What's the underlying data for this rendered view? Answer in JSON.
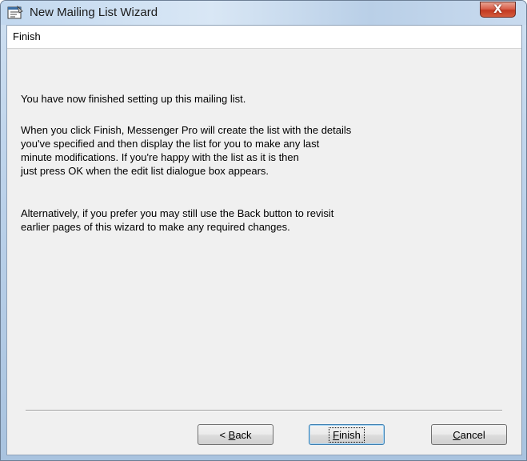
{
  "window": {
    "title": "New Mailing List Wizard",
    "close_glyph": "X",
    "app_icon": "wizard-icon"
  },
  "page": {
    "header": "Finish",
    "paragraphs": [
      "You have now finished setting up this mailing list.",
      "When you click Finish, Messenger Pro will create the list with the details\nyou've specified and then display the list for you to make any last\nminute modifications.  If you're happy with the list as it is then\njust press OK when the edit list dialogue box appears.",
      "Alternatively, if you prefer you may still use the Back button to revisit\nearlier pages of this wizard to make any required changes."
    ]
  },
  "buttons": {
    "back": {
      "label": "< Back",
      "accel_prefix": "< ",
      "accel_key": "B",
      "accel_rest": "ack"
    },
    "finish": {
      "label": "Finish",
      "accel_prefix": "",
      "accel_key": "F",
      "accel_rest": "inish"
    },
    "cancel": {
      "label": "Cancel",
      "accel_prefix": "",
      "accel_key": "C",
      "accel_rest": "ancel"
    }
  },
  "colors": {
    "title_gradient": "#c2d8ef",
    "close_button": "#c23a22",
    "dialog_bg": "#f0f0f0",
    "header_bg": "#ffffff",
    "default_button_border": "#3c7fb1"
  }
}
